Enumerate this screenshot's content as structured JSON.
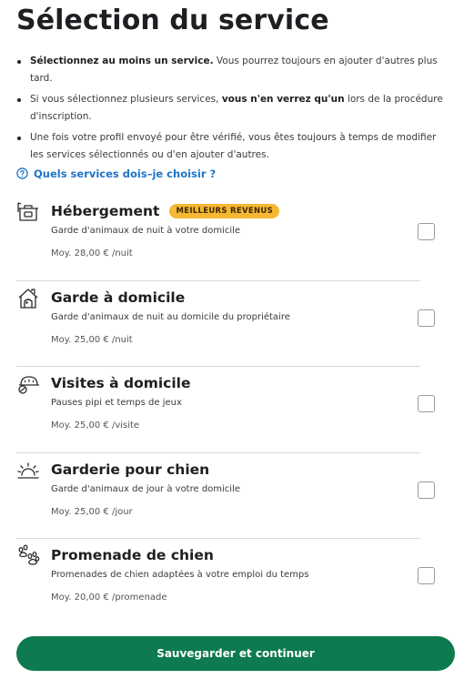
{
  "page": {
    "title": "Sélection du service"
  },
  "intro": {
    "bullets": [
      {
        "strong": "Sélectionnez au moins un service.",
        "pre": "",
        "post": " Vous pourrez toujours en ajouter d'autres plus tard."
      },
      {
        "pre": "Si vous sélectionnez plusieurs services, ",
        "strong": "vous n'en verrez qu'un",
        "post": " lors de la procédure d'inscription."
      },
      {
        "pre": "Une fois votre profil envoyé pour être vérifié, vous êtes toujours à temps de modifier les services sélectionnés ou d'en ajouter d'autres.",
        "strong": "",
        "post": ""
      }
    ]
  },
  "help": {
    "label": "Quels services dois–je choisir ?",
    "icon": "question-circle-icon"
  },
  "services": [
    {
      "title": "Hébergement",
      "badge": "MEILLEURS REVENUS",
      "description": "Garde d'animaux de nuit à votre domicile",
      "price": "Moy. 28,00 € /nuit",
      "icon": "boarding-suitcase-icon",
      "checked": false
    },
    {
      "title": "Garde à domicile",
      "badge": "",
      "description": "Garde d'animaux de nuit au domicile du propriétaire",
      "price": "Moy. 25,00 € /nuit",
      "icon": "house-sitting-icon",
      "checked": false
    },
    {
      "title": "Visites à domicile",
      "badge": "",
      "description": "Pauses pipi et temps de jeux",
      "price": "Moy. 25,00 € /visite",
      "icon": "drop-in-visit-icon",
      "checked": false
    },
    {
      "title": "Garderie pour chien",
      "badge": "",
      "description": "Garde d'animaux de jour à votre domicile",
      "price": "Moy. 25,00 € /jour",
      "icon": "sun-daycare-icon",
      "checked": false
    },
    {
      "title": "Promenade de chien",
      "badge": "",
      "description": "Promenades de chien adaptées à votre emploi du temps",
      "price": "Moy. 20,00 € /promenade",
      "icon": "paw-walking-icon",
      "checked": false
    }
  ],
  "footer": {
    "save_label": "Sauvegarder et continuer"
  },
  "colors": {
    "primary": "#0d7a4f",
    "link": "#1f74c9",
    "badge": "#f7b733",
    "divider": "#d9d9dd"
  }
}
